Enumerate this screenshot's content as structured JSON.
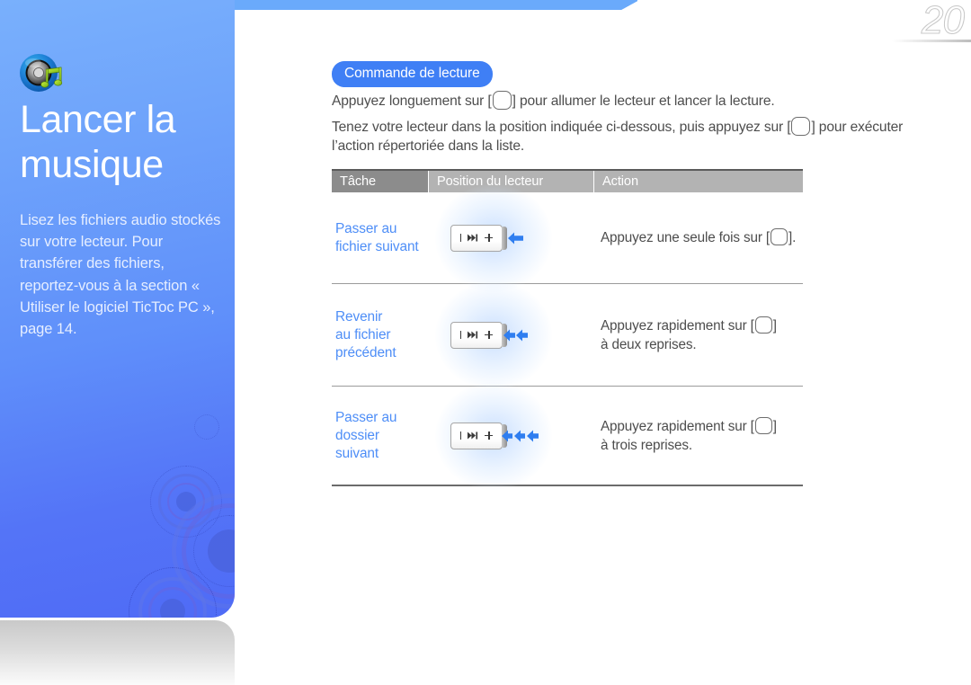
{
  "page": {
    "number": "20",
    "accent_blue": "#4e8ef7",
    "panel_blue": "#5f8ffa",
    "badge_blue": "#3f7ff5",
    "text_gray": "#4d4d4d",
    "header_dark_gray": "#8c8c8c",
    "header_light_gray": "#b3b3b3"
  },
  "sidebar": {
    "icon": "music-speaker-icon",
    "title_line1": "Lancer la",
    "title_line2": "musique",
    "description": "Lisez les fichiers audio stockés sur votre lecteur. Pour transférer des fichiers, reportez-vous à la section « Utiliser le logiciel TicToc PC », page 14."
  },
  "main": {
    "badge": "Commande de lecture",
    "intro_line1_before": "Appuyez longuement sur [",
    "intro_line1_after": "] pour allumer le lecteur et lancer la lecture.",
    "intro_line2_before": "Tenez votre lecteur dans la position indiquée ci-dessous, puis appuyez sur [",
    "intro_line2_after": "] pour exécuter l’action répertoriée dans la liste."
  },
  "table": {
    "headers": [
      "Tâche",
      "Position du lecteur",
      "Action"
    ],
    "rows": [
      {
        "task": "Passer au fichier suivant",
        "task_lines": [
          "Passer au",
          "fichier suivant"
        ],
        "device_icon": "player-device-icon",
        "arrow_count": 1,
        "arrow_direction": "left",
        "action_before": "Appuyez une seule fois sur [",
        "action_after": "].",
        "action_second_line": ""
      },
      {
        "task": "Revenir au fichier précédent",
        "task_lines": [
          "Revenir",
          "au fichier",
          "précédent"
        ],
        "device_icon": "player-device-icon",
        "arrow_count": 2,
        "arrow_direction": "left",
        "action_before": "Appuyez rapidement sur [",
        "action_after": "]",
        "action_second_line": "à deux reprises."
      },
      {
        "task": "Passer au dossier suivant",
        "task_lines": [
          "Passer au",
          "dossier",
          "suivant"
        ],
        "device_icon": "player-device-icon",
        "arrow_count": 3,
        "arrow_direction": "left",
        "action_before": "Appuyez rapidement sur [",
        "action_after": "]",
        "action_second_line": "à trois reprises."
      }
    ]
  }
}
